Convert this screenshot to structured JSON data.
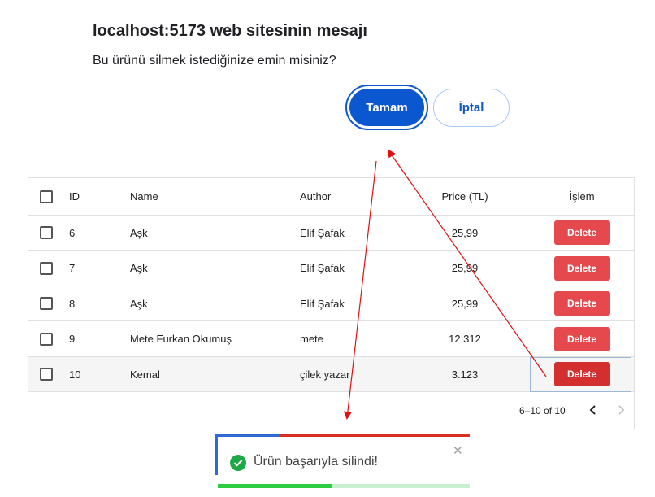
{
  "dialog": {
    "title": "localhost:5173 web sitesinin mesajı",
    "message": "Bu ürünü silmek istediğinize emin misiniz?",
    "ok_label": "Tamam",
    "cancel_label": "İptal"
  },
  "table": {
    "headers": {
      "id": "ID",
      "name": "Name",
      "author": "Author",
      "price": "Price (TL)",
      "action": "İşlem"
    },
    "rows": [
      {
        "id": "6",
        "name": "Aşk",
        "author": "Elif Şafak",
        "price": "25,99",
        "action": "Delete"
      },
      {
        "id": "7",
        "name": "Aşk",
        "author": "Elif Şafak",
        "price": "25,99",
        "action": "Delete"
      },
      {
        "id": "8",
        "name": "Aşk",
        "author": "Elif Şafak",
        "price": "25,99",
        "action": "Delete"
      },
      {
        "id": "9",
        "name": "Mete Furkan Okumuş",
        "author": "mete",
        "price": "12.312",
        "action": "Delete"
      },
      {
        "id": "10",
        "name": "Kemal",
        "author": "çilek yazar",
        "price": "3.123",
        "action": "Delete"
      }
    ],
    "pagination": {
      "range": "6–10 of 10",
      "prev_icon": "chevron-left-icon",
      "next_icon": "chevron-right-icon"
    }
  },
  "toast": {
    "message": "Ürün başarıyla silindi!",
    "close_glyph": "✕",
    "icon": "check-circle-icon",
    "progress": 0.45
  },
  "colors": {
    "primary": "#0b57d0",
    "delete": "#e5484d",
    "success": "#2ecc40",
    "arrow": "#e01010"
  }
}
